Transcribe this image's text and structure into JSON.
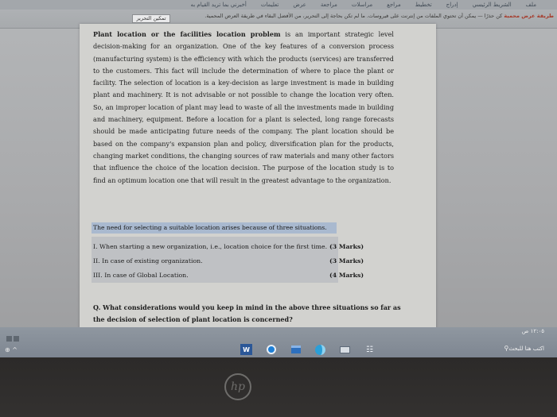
{
  "ribbon": {
    "tabs": [
      "ملف",
      "الشريط الرئيسي",
      "إدراج",
      "تخطيط",
      "مراجع",
      "مراسلات",
      "مراجعة",
      "عرض",
      "تعليمات",
      "أخبرني بما تريد القيام به"
    ]
  },
  "notification": {
    "lead": "طريقة عرض محمية",
    "text": "كن حذرًا — يمكن أن تحتوي الملفات من إنترنت على فيروسات. ما لم تكن بحاجة إلى التحرير، من الأفضل البقاء في طريقة العرض المحمية.",
    "enable_button": "تمكين التحرير"
  },
  "document": {
    "paragraph_lead": "Plant location or the facilities location problem",
    "paragraph_body": " is an important strategic level decision-making for an organization. One of the key features of a conversion process (manufacturing system) is the efficiency with which the products (services) are transferred to the customers. This fact will include the determination of where to place the plant or facility. The selection of location is a key-decision as large investment is made in building plant and machinery. It is not advisable or not possible to change the location very often. So, an improper location of plant may lead to waste of all the investments made in building and machinery, equipment. Before a location for a plant is selected, long range forecasts should be made anticipating future needs of the company. The plant location should be based on the company's expansion plan and policy, diversification plan for the products, changing market conditions, the changing sources of raw materials and many other factors that influence the choice of the location decision. The purpose of the location study is to find an optimum location one that will result in the greatest advantage to the organization.",
    "highlight": "The need for selecting a suitable location arises because of three situations.",
    "situations": [
      {
        "text": "I. When starting a new organization, i.e., location choice for the first time.",
        "marks": "(3 Marks)"
      },
      {
        "text": "II. In case of existing organization.",
        "marks": "(3 Marks)"
      },
      {
        "text": "III. In case of Global Location.",
        "marks": "(4 Marks)"
      }
    ],
    "question": "Q. What considerations would you keep in mind in the above three situations so far as the decision of selection of plant location is concerned?"
  },
  "taskbar": {
    "datetime": "١٢:٠٥ ص",
    "search_placeholder": "اكتب هنا للبحث",
    "apps": [
      "word-icon",
      "browser-circle-icon",
      "store-icon",
      "edge-icon",
      "mail-icon",
      "calculator-icon"
    ],
    "word_letter": "W",
    "calc_symbol": "☷"
  },
  "bezel": {
    "logo": "hp"
  },
  "colors": {
    "highlight": "#a9b9cf",
    "page": "#d2d2cf",
    "taskbar": "#8a929b"
  }
}
